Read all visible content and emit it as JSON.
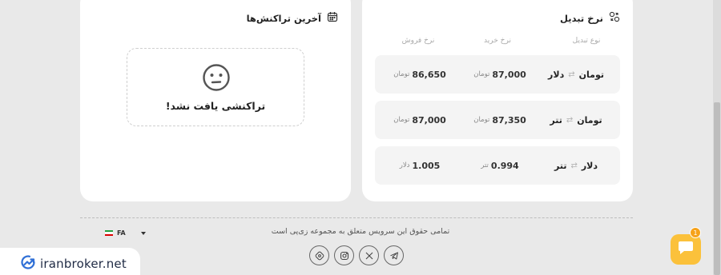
{
  "transactions": {
    "title": "آخرین تراکنش‌ها",
    "icon": "calendar-icon",
    "empty_icon": "neutral-face-icon",
    "empty_text": "تراکنشی یافت نشد!"
  },
  "rates": {
    "title": "نرخ تبدیل",
    "icon": "exchange-icon",
    "headers": {
      "type": "نوع تبدیل",
      "buy": "نرخ خرید",
      "sell": "نرخ فروش"
    },
    "rows": [
      {
        "from": "دلار",
        "to": "تومان",
        "buy": "87,000",
        "buy_unit": "تومان",
        "sell": "86,650",
        "sell_unit": "تومان"
      },
      {
        "from": "تتر",
        "to": "تومان",
        "buy": "87,350",
        "buy_unit": "تومان",
        "sell": "87,000",
        "sell_unit": "تومان"
      },
      {
        "from": "تتر",
        "to": "دلار",
        "buy": "0.994",
        "buy_unit": "تتر",
        "sell": "1.005",
        "sell_unit": "دلار"
      }
    ]
  },
  "footer": {
    "copyright": "تمامی حقوق این سرویس متعلق به مجموعه زی‌پی است",
    "language": "FA",
    "socials": [
      "telegram-icon",
      "x-icon",
      "instagram-icon",
      "bale-icon"
    ]
  },
  "brand": {
    "name": "iranbroker.net"
  },
  "chat": {
    "badge": "1"
  },
  "colors": {
    "accent": "#fbc13b",
    "badge": "#f6a21a",
    "brand": "#2f6fd6"
  }
}
